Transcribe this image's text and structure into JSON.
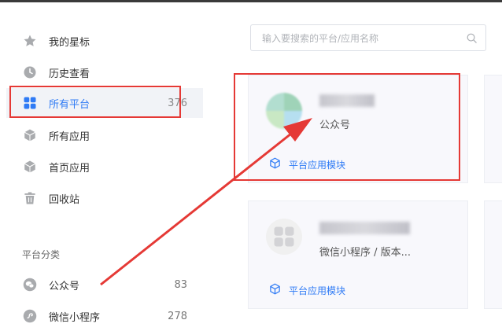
{
  "sidebar": {
    "items": [
      {
        "label": "我的星标",
        "icon": "star-icon"
      },
      {
        "label": "历史查看",
        "icon": "clock-icon"
      },
      {
        "label": "所有平台",
        "count": "376",
        "icon": "grid-icon"
      },
      {
        "label": "所有应用",
        "icon": "cube-icon"
      },
      {
        "label": "首页应用",
        "icon": "cube-icon"
      },
      {
        "label": "回收站",
        "icon": "trash-icon"
      }
    ],
    "group_title": "平台分类",
    "categories": [
      {
        "label": "公众号",
        "count": "83",
        "icon": "wechat-icon"
      },
      {
        "label": "微信小程序",
        "count": "278",
        "icon": "mini-program-icon"
      }
    ]
  },
  "search": {
    "placeholder": "输入要搜索的平台/应用名称"
  },
  "cards": [
    {
      "category": "公众号",
      "module_label": "平台应用模块"
    },
    {
      "category": "微信小程序 / 版本...",
      "module_label": "平台应用模块"
    }
  ],
  "colors": {
    "accent": "#2f7bf5",
    "annotation": "#e53935",
    "active_bg": "#f1f3f7"
  }
}
